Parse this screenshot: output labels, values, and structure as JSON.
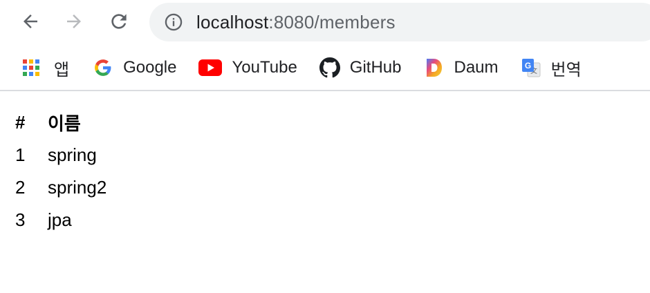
{
  "browser": {
    "url_host": "localhost",
    "url_rest": ":8080/members",
    "nav": {
      "back_icon": "arrow-left-icon",
      "forward_icon": "arrow-right-icon",
      "reload_icon": "reload-icon",
      "info_icon": "info-circle-icon"
    }
  },
  "bookmarks": [
    {
      "label": "앱",
      "icon": "apps-grid-icon"
    },
    {
      "label": "Google",
      "icon": "google-icon"
    },
    {
      "label": "YouTube",
      "icon": "youtube-icon"
    },
    {
      "label": "GitHub",
      "icon": "github-icon"
    },
    {
      "label": "Daum",
      "icon": "daum-icon"
    },
    {
      "label": "번역",
      "icon": "google-translate-icon"
    }
  ],
  "members_table": {
    "headers": [
      "#",
      "이름"
    ],
    "rows": [
      {
        "id": "1",
        "name": "spring"
      },
      {
        "id": "2",
        "name": "spring2"
      },
      {
        "id": "3",
        "name": "jpa"
      }
    ]
  },
  "colors": {
    "omnibox_bg": "#f1f3f4",
    "bookmark_border": "#dadce0",
    "youtube_red": "#ff0000"
  }
}
